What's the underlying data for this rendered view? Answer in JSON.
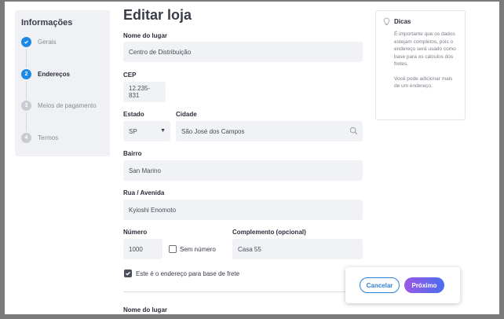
{
  "stepper": {
    "title": "Informações",
    "steps": [
      {
        "num": "✓",
        "label": "Gerais",
        "state": "done"
      },
      {
        "num": "2",
        "label": "Endereços",
        "state": "active"
      },
      {
        "num": "3",
        "label": "Meios de pagamento",
        "state": "todo"
      },
      {
        "num": "4",
        "label": "Termos",
        "state": "todo"
      }
    ]
  },
  "page": {
    "title": "Editar loja"
  },
  "form": {
    "place_name_label": "Nome do lugar",
    "place_name_value": "Centro de Distribuição",
    "cep_label": "CEP",
    "cep_value": "12.235-831",
    "state_label": "Estado",
    "state_value": "SP",
    "city_label": "Cidade",
    "city_value": "São José dos Campos",
    "district_label": "Bairro",
    "district_value": "San Marino",
    "street_label": "Rua / Avenida",
    "street_value": "Kyioshi Enomoto",
    "number_label": "Número",
    "number_value": "1000",
    "no_number_label": "Sem número",
    "complement_label": "Complemento (opcional)",
    "complement_value": "Casa 55",
    "freight_base_label": "Este é o endereço para base de frete",
    "next_place_name_label": "Nome do lugar"
  },
  "tips": {
    "title": "Dicas",
    "p1": "É importante que os dados estejam completos, pois o endereço será usado como base para os cálculos dos fretes.",
    "p2": "Você pode adicionar mais de um endereço."
  },
  "actions": {
    "cancel_label": "Cancelar",
    "next_label": "Próximo"
  },
  "colors": {
    "accent": "#1e88e5",
    "next_gradient_start": "#9b59e6",
    "next_gradient_end": "#4a6cf0"
  }
}
